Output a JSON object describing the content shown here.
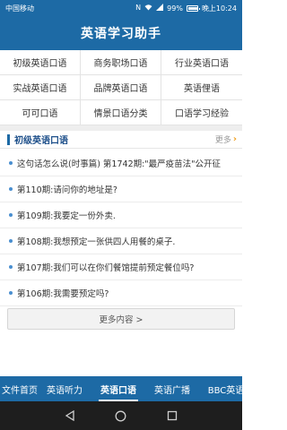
{
  "status_bar": {
    "carrier": "中国移动",
    "battery_level": "99%",
    "battery_fraction": 0.99,
    "time": "晚上10:24"
  },
  "app": {
    "title": "英语学习助手"
  },
  "categories": [
    "初级英语口语",
    "商务职场口语",
    "行业英语口语",
    "实战英语口语",
    "品牌英语口语",
    "英语俚语",
    "可可口语",
    "情景口语分类",
    "口语学习经验"
  ],
  "section": {
    "title": "初级英语口语",
    "more_label": "更多",
    "items": [
      "这句话怎么说(时事篇) 第1742期:\"最严疫苗法\"公开征",
      "第110期:请问你的地址是?",
      "第109期:我要定一份外卖.",
      "第108期:我想预定一张供四人用餐的桌子.",
      "第107期:我们可以在你们餐馆提前预定餐位吗?",
      "第106期:我需要预定吗?"
    ]
  },
  "more_button": {
    "label": "更多内容 >"
  },
  "tabs": {
    "items": [
      "文件首页",
      "英语听力",
      "英语口语",
      "英语广播",
      "BBC英语"
    ],
    "active_index": 2
  },
  "colors": {
    "primary": "#1d6aa5",
    "accent": "#f0a020"
  },
  "icons": {
    "status": [
      "nfc-icon",
      "wifi-icon",
      "signal-icon",
      "battery-icon"
    ],
    "nav": [
      "back-icon",
      "home-icon",
      "recents-icon"
    ]
  }
}
